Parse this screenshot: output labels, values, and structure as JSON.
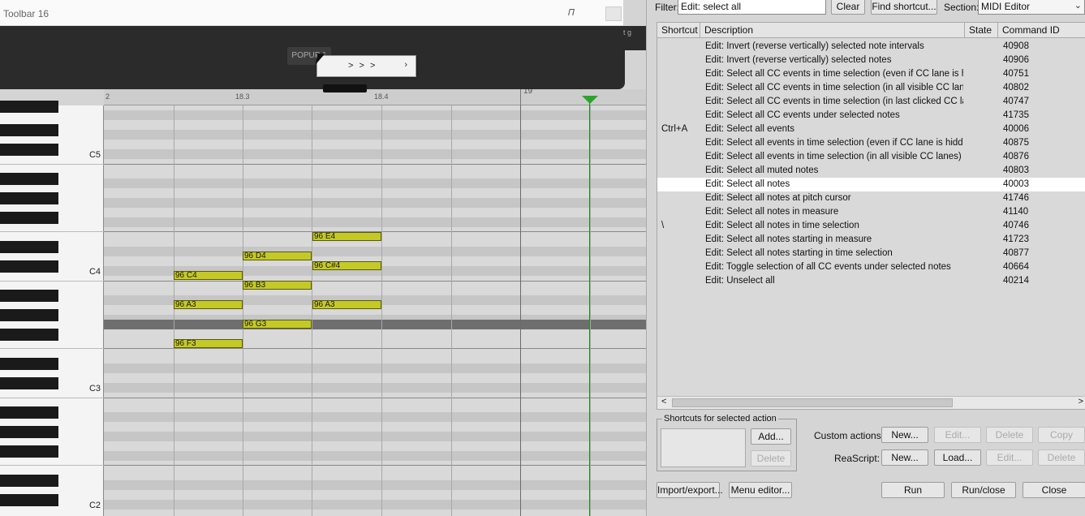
{
  "toolbar": {
    "title": "Toolbar 16",
    "popup_button": "POPUP 1",
    "menu_item": "> > >",
    "menu_arrow": "›",
    "side_text": "t\ng"
  },
  "ruler": {
    "ticks": [
      "2",
      "18.3",
      "18.4",
      "19"
    ]
  },
  "piano": {
    "octave_labels": [
      "C5",
      "C4",
      "C3",
      "C2"
    ]
  },
  "notes": [
    "96 E4",
    "96 D4",
    "96 C#4",
    "96 C4",
    "96 B3",
    "96 A3",
    "96 A3",
    "96 G3",
    "96 F3"
  ],
  "actions": {
    "filter_label": "Filter:",
    "filter_value": "Edit: select all",
    "clear": "Clear",
    "find_shortcut": "Find shortcut...",
    "section_label": "Section:",
    "section_value": "MIDI Editor",
    "columns": [
      "Shortcut",
      "Description",
      "State",
      "Command ID"
    ],
    "rows": [
      {
        "shortcut": "",
        "desc": "Edit: Invert (reverse vertically) selected note intervals",
        "id": "40908"
      },
      {
        "shortcut": "",
        "desc": "Edit: Invert (reverse vertically) selected notes",
        "id": "40906"
      },
      {
        "shortcut": "",
        "desc": "Edit: Select all CC events in time selection (even if CC lane is hid...",
        "id": "40751"
      },
      {
        "shortcut": "",
        "desc": "Edit: Select all CC events in time selection (in all visible CC lanes)",
        "id": "40802"
      },
      {
        "shortcut": "",
        "desc": "Edit: Select all CC events in time selection (in last clicked CC lane)",
        "id": "40747"
      },
      {
        "shortcut": "",
        "desc": "Edit: Select all CC events under selected notes",
        "id": "41735"
      },
      {
        "shortcut": "Ctrl+A",
        "desc": "Edit: Select all events",
        "id": "40006"
      },
      {
        "shortcut": "",
        "desc": "Edit: Select all events in time selection (even if CC lane is hidden)",
        "id": "40875"
      },
      {
        "shortcut": "",
        "desc": "Edit: Select all events in time selection (in all visible CC lanes)",
        "id": "40876"
      },
      {
        "shortcut": "",
        "desc": "Edit: Select all muted notes",
        "id": "40803"
      },
      {
        "shortcut": "",
        "desc": "Edit: Select all notes",
        "id": "40003"
      },
      {
        "shortcut": "",
        "desc": "Edit: Select all notes at pitch cursor",
        "id": "41746"
      },
      {
        "shortcut": "",
        "desc": "Edit: Select all notes in measure",
        "id": "41140"
      },
      {
        "shortcut": "\\",
        "desc": "Edit: Select all notes in time selection",
        "id": "40746"
      },
      {
        "shortcut": "",
        "desc": "Edit: Select all notes starting in measure",
        "id": "41723"
      },
      {
        "shortcut": "",
        "desc": "Edit: Select all notes starting in time selection",
        "id": "40877"
      },
      {
        "shortcut": "",
        "desc": "Edit: Toggle selection of all CC events under selected notes",
        "id": "40664"
      },
      {
        "shortcut": "",
        "desc": "Edit: Unselect all",
        "id": "40214"
      }
    ],
    "selected_index": 10,
    "shortcuts_legend": "Shortcuts for selected action",
    "add": "Add...",
    "delete": "Delete",
    "custom_actions_label": "Custom actions:",
    "reascript_label": "ReaScript:",
    "new": "New...",
    "edit": "Edit...",
    "copy": "Copy",
    "load": "Load...",
    "import_export": "Import/export...",
    "menu_editor": "Menu editor...",
    "run": "Run",
    "run_close": "Run/close",
    "close": "Close"
  },
  "colors": {
    "note_fill": "#c4c927",
    "cursor": "#1d8a1d",
    "toolbar_bg": "#2b2b2b"
  }
}
